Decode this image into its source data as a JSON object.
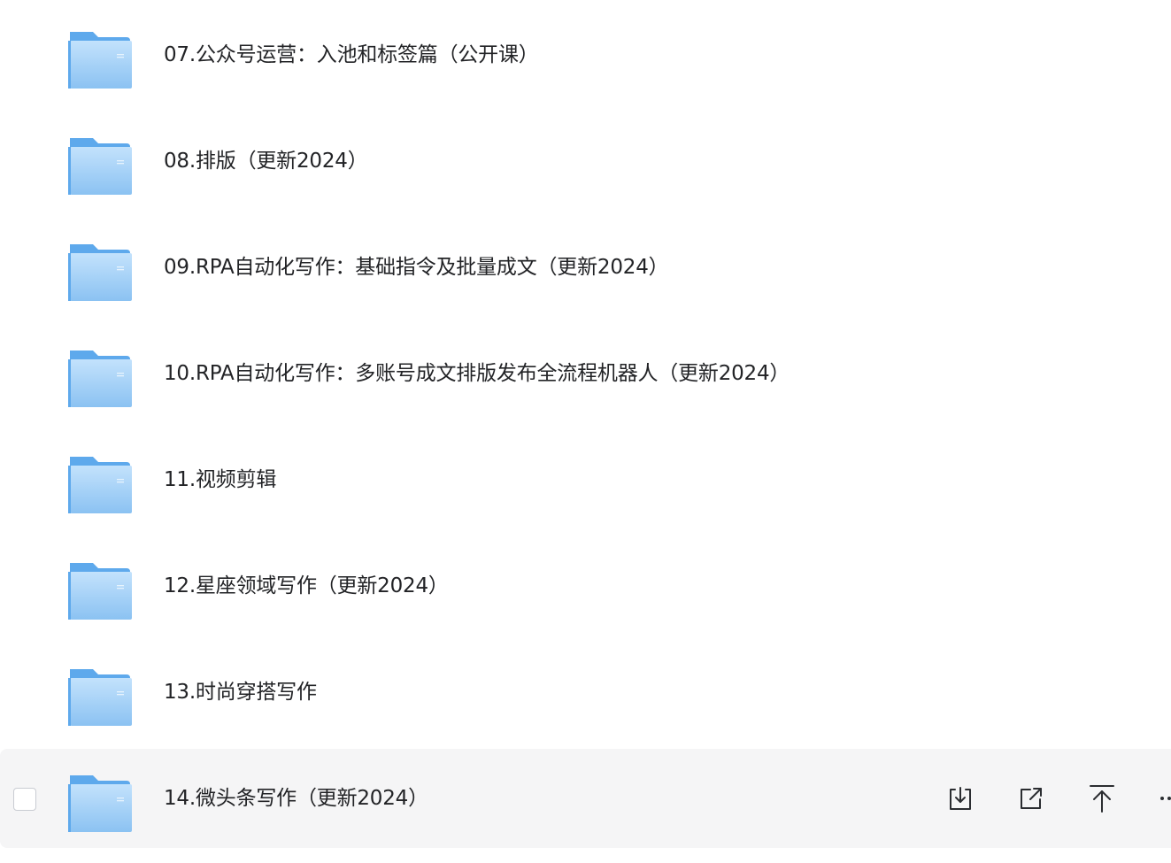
{
  "files": [
    {
      "name": "07.公众号运营：入池和标签篇（公开课）",
      "type": "folder-icon"
    },
    {
      "name": "08.排版（更新2024）",
      "type": "folder-icon"
    },
    {
      "name": "09.RPA自动化写作：基础指令及批量成文（更新2024）",
      "type": "folder-icon"
    },
    {
      "name": "10.RPA自动化写作：多账号成文排版发布全流程机器人（更新2024）",
      "type": "folder-icon"
    },
    {
      "name": "11.视频剪辑",
      "type": "folder-icon"
    },
    {
      "name": "12.星座领域写作（更新2024）",
      "type": "folder-icon"
    },
    {
      "name": "13.时尚穿搭写作",
      "type": "folder-icon"
    },
    {
      "name": "14.微头条写作（更新2024）",
      "type": "folder-icon"
    }
  ],
  "hovered_row_actions": [
    "download-icon",
    "share-icon",
    "move-to-top-icon",
    "more-icon"
  ],
  "colors": {
    "folder_front_top": "#bfe0fb",
    "folder_front_bottom": "#8cc3f3",
    "folder_back": "#5ea9ec",
    "hover_bg": "#f5f5f6",
    "text": "#222326",
    "icon": "#2b2d31"
  }
}
